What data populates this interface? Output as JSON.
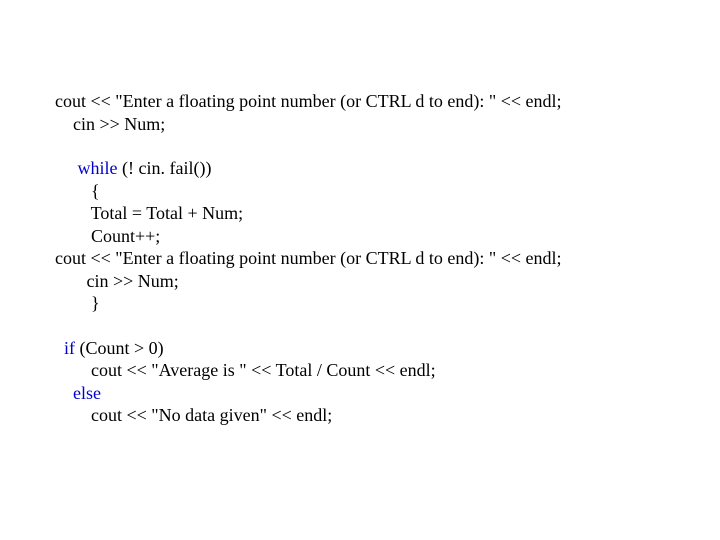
{
  "code": {
    "l1a": "cout << \"Enter a floating point number (or CTRL d to end): \" << endl;",
    "l1b": "    cin >> Num;",
    "l2kw": "while",
    "l2rest": " (! cin. fail())",
    "l2indent": "     ",
    "l3": "        {",
    "l4": "        Total = Total + Num;",
    "l5": "        Count++;",
    "l6": "cout << \"Enter a floating point number (or CTRL d to end): \" << endl;",
    "l7": "       cin >> Num;",
    "l8": "        }",
    "l9indent": "  ",
    "l9kw": "if",
    "l9rest": " (Count > 0)",
    "l10": "        cout << \"Average is \" << Total / Count << endl;",
    "l11indent": "    ",
    "l11kw": "else",
    "l12": "        cout << \"No data given\" << endl;"
  }
}
